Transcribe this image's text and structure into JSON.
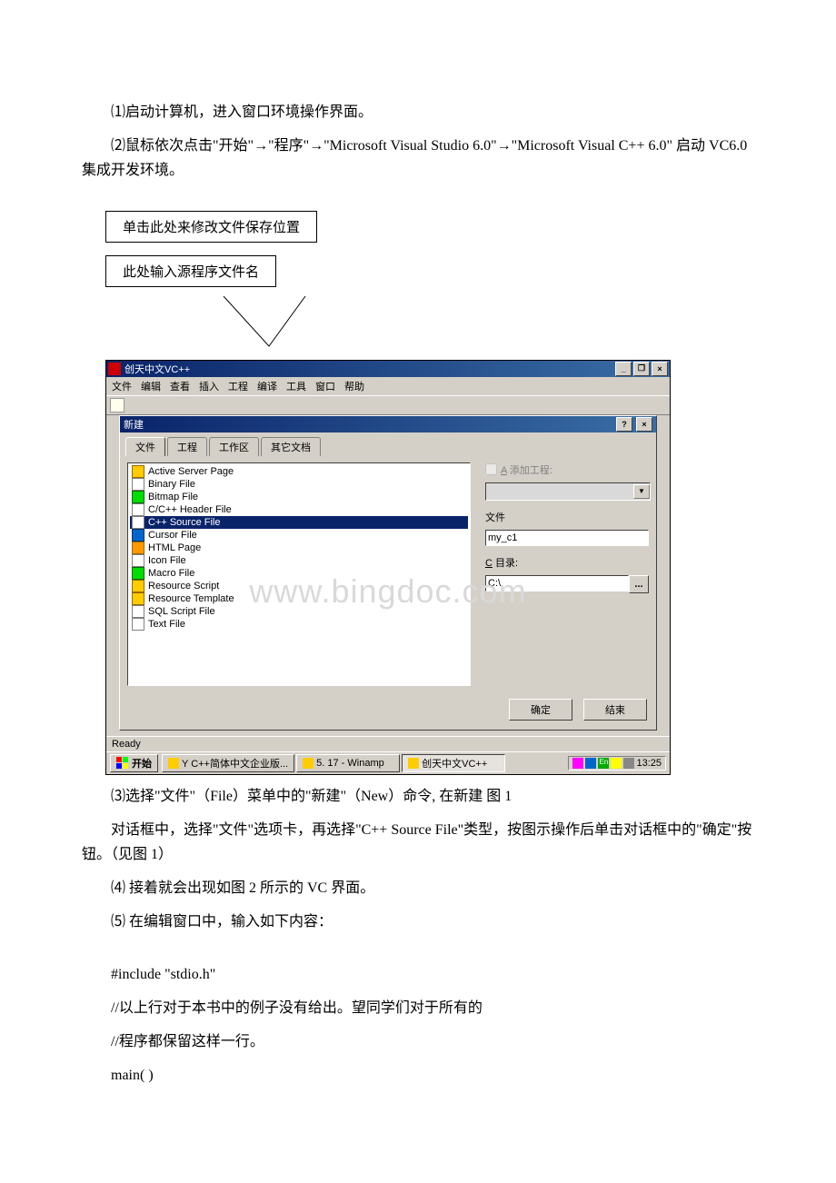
{
  "body": {
    "p1": "⑴启动计算机，进入窗口环境操作界面。",
    "p2": "⑵鼠标依次点击\"开始\"→\"程序\"→\"Microsoft Visual Studio 6.0\"→\"Microsoft Visual C++ 6.0\" 启动 VC6.0 集成开发环境。",
    "p3": "⑶选择\"文件\"（File）菜单中的\"新建\"（New）命令, 在新建 图 1",
    "p4": "对话框中，选择\"文件\"选项卡，再选择\"C++ Source File\"类型，按图示操作后单击对话框中的\"确定\"按钮。（见图 1）",
    "p5": "⑷ 接着就会出现如图 2 所示的 VC 界面。",
    "p6": "⑸ 在编辑窗口中，输入如下内容：",
    "code1": "#include \"stdio.h\"",
    "code2": "//以上行对于本书中的例子没有给出。望同学们对于所有的",
    "code3": "//程序都保留这样一行。",
    "code4": "main( )"
  },
  "callouts": {
    "top": "单击此处来修改文件保存位置",
    "bottom": "此处输入源程序文件名"
  },
  "window": {
    "title": "创天中文VC++",
    "menus": [
      "文件",
      "编辑",
      "查看",
      "插入",
      "工程",
      "编译",
      "工具",
      "窗口",
      "帮助"
    ]
  },
  "dialog": {
    "title": "新建",
    "tabs": {
      "t1": "文件",
      "t2": "工程",
      "t3": "工作区",
      "t4": "其它文档"
    },
    "checkbox_prefix": "A",
    "checkbox_label": "添加工程:",
    "file_label": "文件",
    "file_value": "my_c1",
    "dir_prefix": "C",
    "dir_label": "目录:",
    "dir_value": "C:\\",
    "ok": "确定",
    "cancel": "结束",
    "files": [
      {
        "icon": "yellow",
        "name": "Active Server Page"
      },
      {
        "icon": "white",
        "name": "Binary File"
      },
      {
        "icon": "green",
        "name": "Bitmap File"
      },
      {
        "icon": "white",
        "name": "C/C++ Header File"
      },
      {
        "icon": "white",
        "name": "C++ Source File",
        "selected": true
      },
      {
        "icon": "blue",
        "name": "Cursor File"
      },
      {
        "icon": "orange",
        "name": "HTML Page"
      },
      {
        "icon": "white",
        "name": "Icon File"
      },
      {
        "icon": "green",
        "name": "Macro File"
      },
      {
        "icon": "yellow",
        "name": "Resource Script"
      },
      {
        "icon": "yellow",
        "name": "Resource Template"
      },
      {
        "icon": "white",
        "name": "SQL Script File"
      },
      {
        "icon": "white",
        "name": "Text File"
      }
    ]
  },
  "statusbar": {
    "text": "Ready"
  },
  "taskbar": {
    "start": "开始",
    "items": [
      {
        "label": "Y C++简体中文企业版..."
      },
      {
        "label": "5. 17 - Winamp"
      },
      {
        "label": "创天中文VC++",
        "active": true
      }
    ],
    "time": "13:25"
  },
  "watermark": "www.bingdoc.com"
}
